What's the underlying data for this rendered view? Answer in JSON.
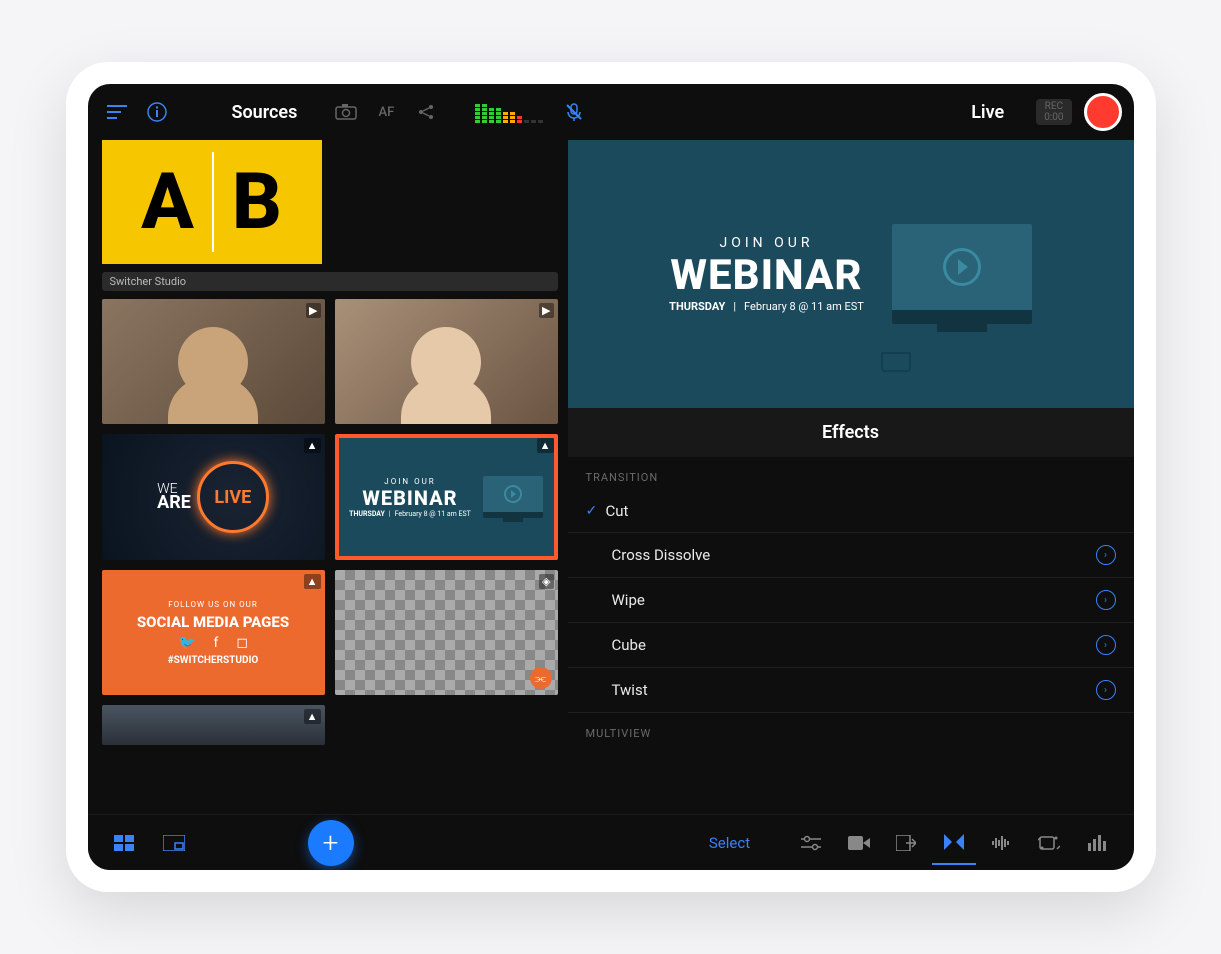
{
  "header": {
    "sources_title": "Sources",
    "af_label": "AF",
    "live_title": "Live",
    "rec_label": "REC",
    "rec_time": "0:00"
  },
  "sources": {
    "ab_a": "A",
    "ab_b": "B",
    "section_label": "Switcher Studio",
    "tiles": {
      "live_we": "WE",
      "live_are": "ARE",
      "live_badge": "LIVE",
      "webinar_join": "JOIN OUR",
      "webinar_title": "WEBINAR",
      "webinar_day": "THURSDAY",
      "webinar_time": "February 8 @ 11 am EST",
      "social_follow": "FOLLOW US ON OUR",
      "social_title": "SOCIAL MEDIA PAGES",
      "social_hashtag": "#SWITCHERSTUDIO"
    }
  },
  "preview": {
    "join": "JOIN OUR",
    "title": "WEBINAR",
    "day": "THURSDAY",
    "time": "February 8 @ 11 am EST"
  },
  "effects": {
    "header": "Effects",
    "transition_label": "TRANSITION",
    "multiview_label": "MULTIVIEW",
    "items": [
      {
        "label": "Cut",
        "checked": true,
        "disclosure": false
      },
      {
        "label": "Cross Dissolve",
        "checked": false,
        "disclosure": true
      },
      {
        "label": "Wipe",
        "checked": false,
        "disclosure": true
      },
      {
        "label": "Cube",
        "checked": false,
        "disclosure": true
      },
      {
        "label": "Twist",
        "checked": false,
        "disclosure": true
      }
    ]
  },
  "bottom": {
    "select_label": "Select"
  }
}
